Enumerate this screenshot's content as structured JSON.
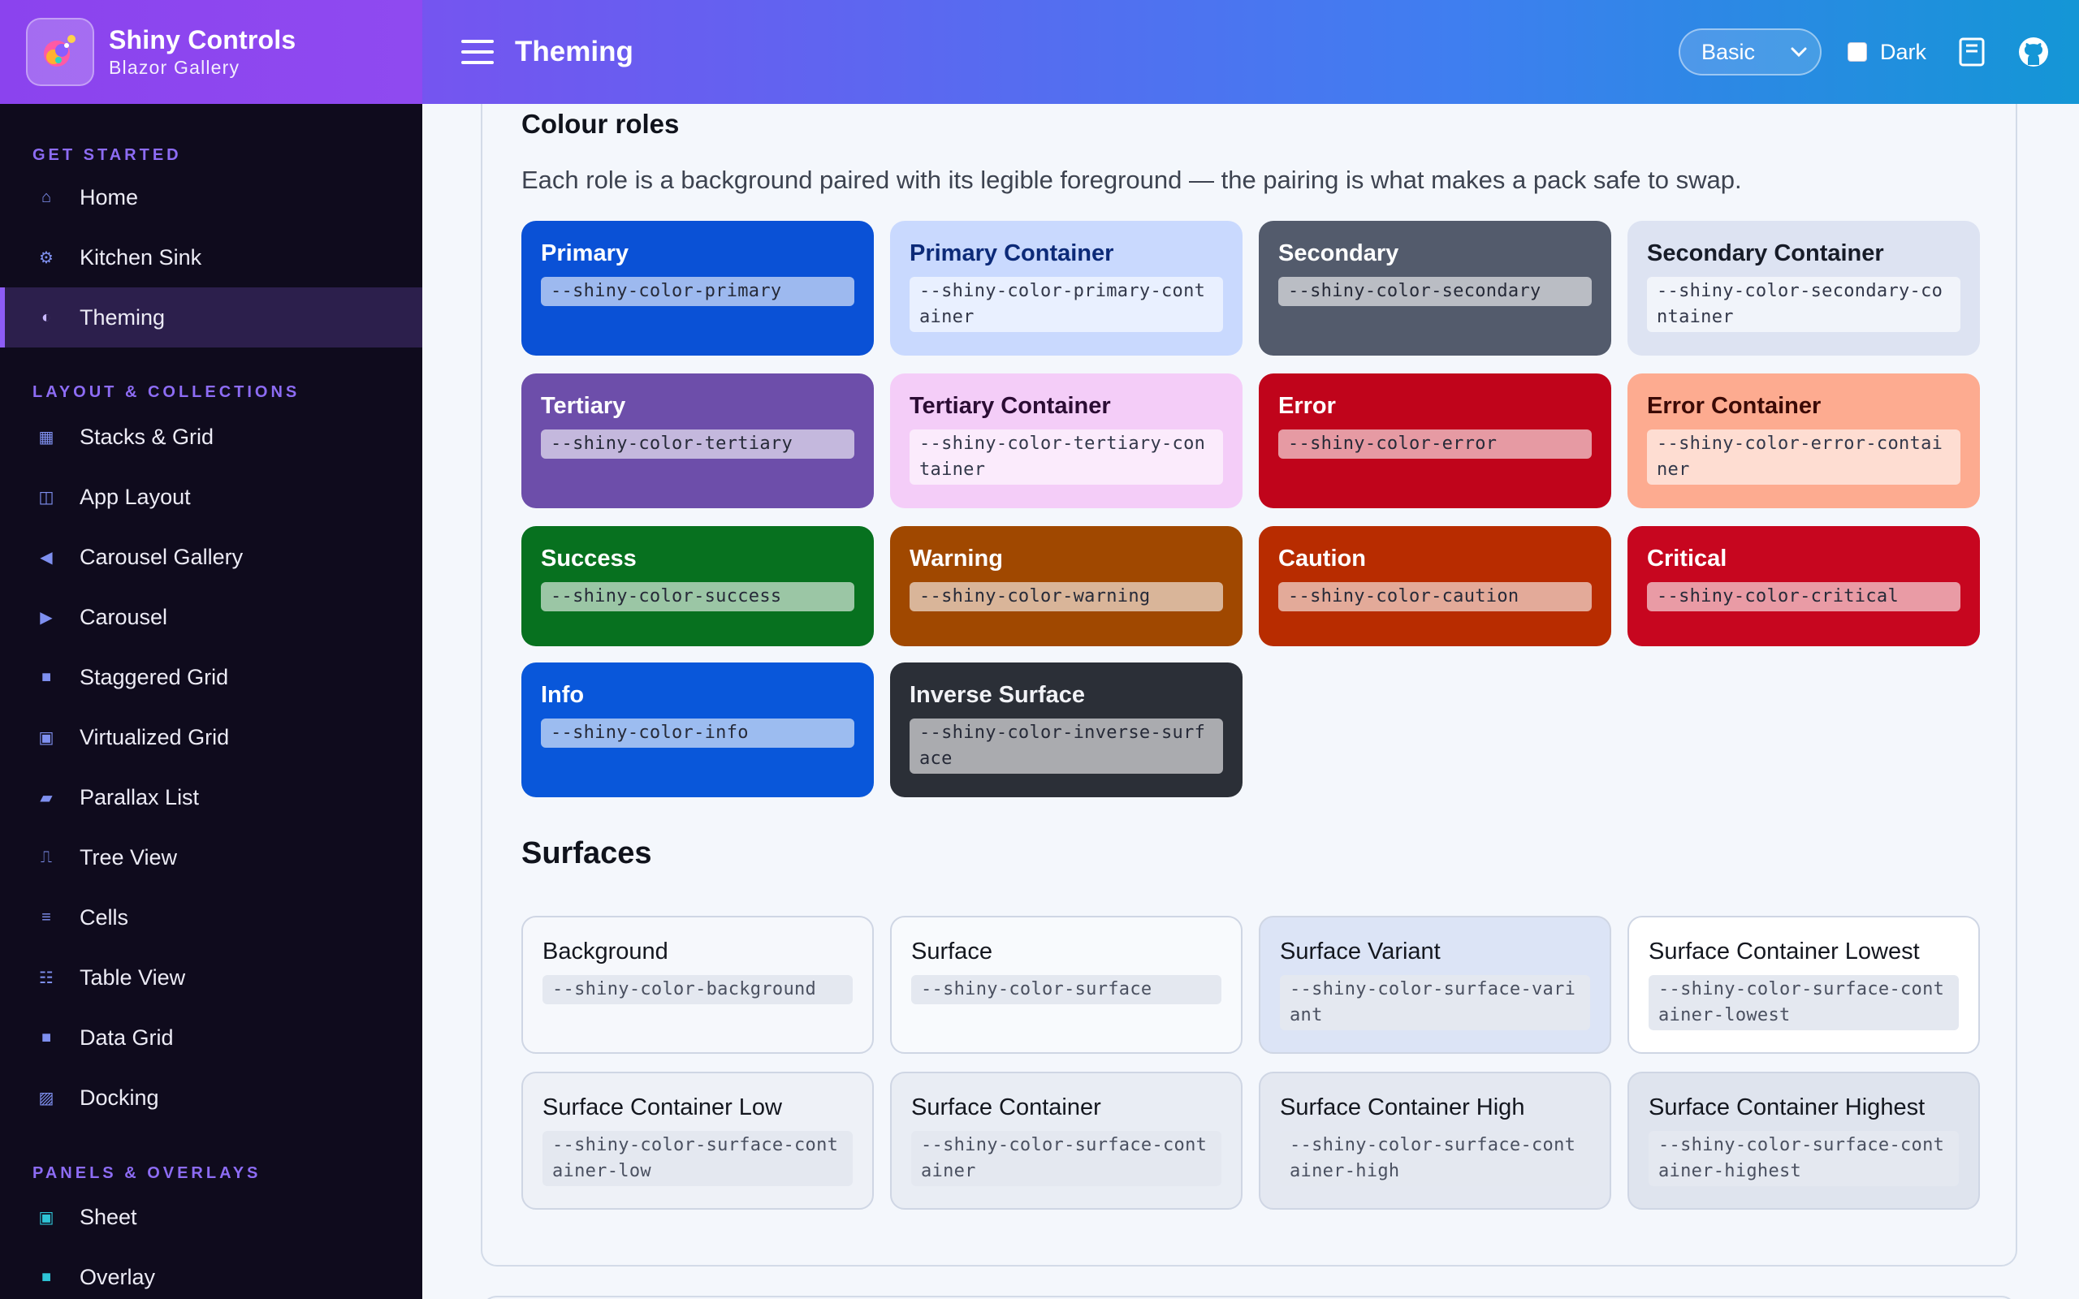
{
  "brand": {
    "title": "Shiny Controls",
    "subtitle": "Blazor Gallery"
  },
  "header": {
    "page_title": "Theming",
    "pack_select": {
      "value": "Basic"
    },
    "dark_label": "Dark"
  },
  "sidebar": {
    "sections": [
      {
        "title": "GET STARTED",
        "items": [
          {
            "label": "Home",
            "icon": "home-icon"
          },
          {
            "label": "Kitchen Sink",
            "icon": "gear-icon"
          },
          {
            "label": "Theming",
            "icon": "half-circle-icon",
            "active": true
          }
        ]
      },
      {
        "title": "LAYOUT & COLLECTIONS",
        "items": [
          {
            "label": "Stacks & Grid",
            "icon": "grid-icon"
          },
          {
            "label": "App Layout",
            "icon": "layout-icon"
          },
          {
            "label": "Carousel Gallery",
            "icon": "triangle-left-icon"
          },
          {
            "label": "Carousel",
            "icon": "triangle-right-icon"
          },
          {
            "label": "Staggered Grid",
            "icon": "square-icon"
          },
          {
            "label": "Virtualized Grid",
            "icon": "square-outline-icon"
          },
          {
            "label": "Parallax List",
            "icon": "parallelogram-icon"
          },
          {
            "label": "Tree View",
            "icon": "tree-icon"
          },
          {
            "label": "Cells",
            "icon": "lines-icon"
          },
          {
            "label": "Table View",
            "icon": "table-icon"
          },
          {
            "label": "Data Grid",
            "icon": "square-icon"
          },
          {
            "label": "Docking",
            "icon": "hatched-square-icon"
          }
        ]
      },
      {
        "title": "PANELS & OVERLAYS",
        "items": [
          {
            "label": "Sheet",
            "icon": "sheet-icon"
          },
          {
            "label": "Overlay",
            "icon": "overlay-icon"
          }
        ]
      }
    ]
  },
  "colour_roles": {
    "title": "Colour roles",
    "description": "Each role is a background paired with its legible foreground — the pairing is what makes a pack safe to swap.",
    "roles": [
      {
        "name": "Primary",
        "token": "--shiny-color-primary",
        "bg": "#0a51d6",
        "fg": "#ffffff"
      },
      {
        "name": "Primary Container",
        "token": "--shiny-color-primary-container",
        "bg": "#c9d9fe",
        "fg": "#0c2a78"
      },
      {
        "name": "Secondary",
        "token": "--shiny-color-secondary",
        "bg": "#535b6c",
        "fg": "#ffffff"
      },
      {
        "name": "Secondary Container",
        "token": "--shiny-color-secondary-container",
        "bg": "#dde3f2",
        "fg": "#171c28"
      },
      {
        "name": "Tertiary",
        "token": "--shiny-color-tertiary",
        "bg": "#6d4eaa",
        "fg": "#ffffff"
      },
      {
        "name": "Tertiary Container",
        "token": "--shiny-color-tertiary-container",
        "bg": "#f4cdf8",
        "fg": "#2b0c34"
      },
      {
        "name": "Error",
        "token": "--shiny-color-error",
        "bg": "#c0041b",
        "fg": "#ffffff"
      },
      {
        "name": "Error Container",
        "token": "--shiny-color-error-container",
        "bg": "#fdab90",
        "fg": "#3b0a06"
      },
      {
        "name": "Success",
        "token": "--shiny-color-success",
        "bg": "#07711f",
        "fg": "#ffffff"
      },
      {
        "name": "Warning",
        "token": "--shiny-color-warning",
        "bg": "#a04800",
        "fg": "#ffffff"
      },
      {
        "name": "Caution",
        "token": "--shiny-color-caution",
        "bg": "#b82c00",
        "fg": "#ffffff"
      },
      {
        "name": "Critical",
        "token": "--shiny-color-critical",
        "bg": "#c7061f",
        "fg": "#ffffff"
      },
      {
        "name": "Info",
        "token": "--shiny-color-info",
        "bg": "#0957da",
        "fg": "#ffffff"
      },
      {
        "name": "Inverse Surface",
        "token": "--shiny-color-inverse-surface",
        "bg": "#2b2f37",
        "fg": "#f1f2f6"
      }
    ]
  },
  "surfaces": {
    "title": "Surfaces",
    "items": [
      {
        "name": "Background",
        "token": "--shiny-color-background",
        "bg": "#f6f8fc"
      },
      {
        "name": "Surface",
        "token": "--shiny-color-surface",
        "bg": "#f8fafd"
      },
      {
        "name": "Surface Variant",
        "token": "--shiny-color-surface-variant",
        "bg": "#dce4f6"
      },
      {
        "name": "Surface Container Lowest",
        "token": "--shiny-color-surface-container-lowest",
        "bg": "#ffffff"
      },
      {
        "name": "Surface Container Low",
        "token": "--shiny-color-surface-container-low",
        "bg": "#eef1f7"
      },
      {
        "name": "Surface Container",
        "token": "--shiny-color-surface-container",
        "bg": "#e9edf4"
      },
      {
        "name": "Surface Container High",
        "token": "--shiny-color-surface-container-high",
        "bg": "#e4e8f1"
      },
      {
        "name": "Surface Container Highest",
        "token": "--shiny-color-surface-container-highest",
        "bg": "#dfe4ee"
      }
    ]
  }
}
